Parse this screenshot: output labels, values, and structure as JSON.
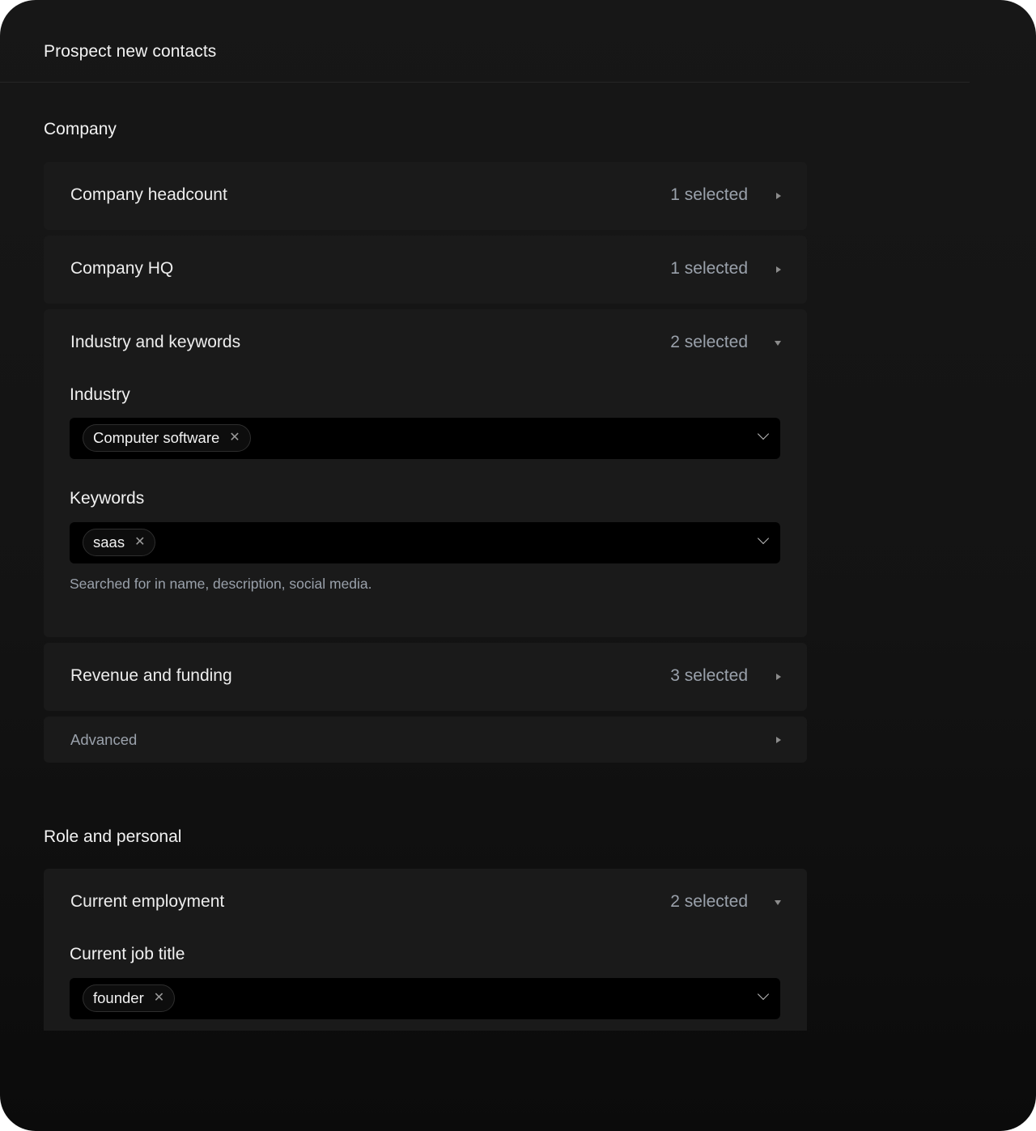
{
  "header": {
    "title": "Prospect new contacts"
  },
  "company": {
    "heading": "Company",
    "headcount": {
      "label": "Company headcount",
      "count": "1 selected"
    },
    "hq": {
      "label": "Company HQ",
      "count": "1 selected"
    },
    "industry_keywords": {
      "label": "Industry and keywords",
      "count": "2 selected",
      "industry": {
        "label": "Industry",
        "tags": [
          "Computer software"
        ]
      },
      "keywords": {
        "label": "Keywords",
        "tags": [
          "saas"
        ],
        "helper": "Searched for in name, description, social media."
      }
    },
    "revenue": {
      "label": "Revenue and funding",
      "count": "3 selected"
    },
    "advanced": {
      "label": "Advanced"
    }
  },
  "role": {
    "heading": "Role and personal",
    "employment": {
      "label": "Current employment",
      "count": "2 selected",
      "job_title": {
        "label": "Current job title",
        "tags": [
          "founder"
        ]
      }
    }
  },
  "icons": {
    "collapsed": "caret-right-icon",
    "expanded": "caret-down-icon",
    "remove": "close-icon",
    "dropdown": "chevron-down-icon"
  },
  "colors": {
    "background": "#141414",
    "panel": "#1a1a1a",
    "input": "#000000",
    "muted_text": "#9aa1ab"
  }
}
